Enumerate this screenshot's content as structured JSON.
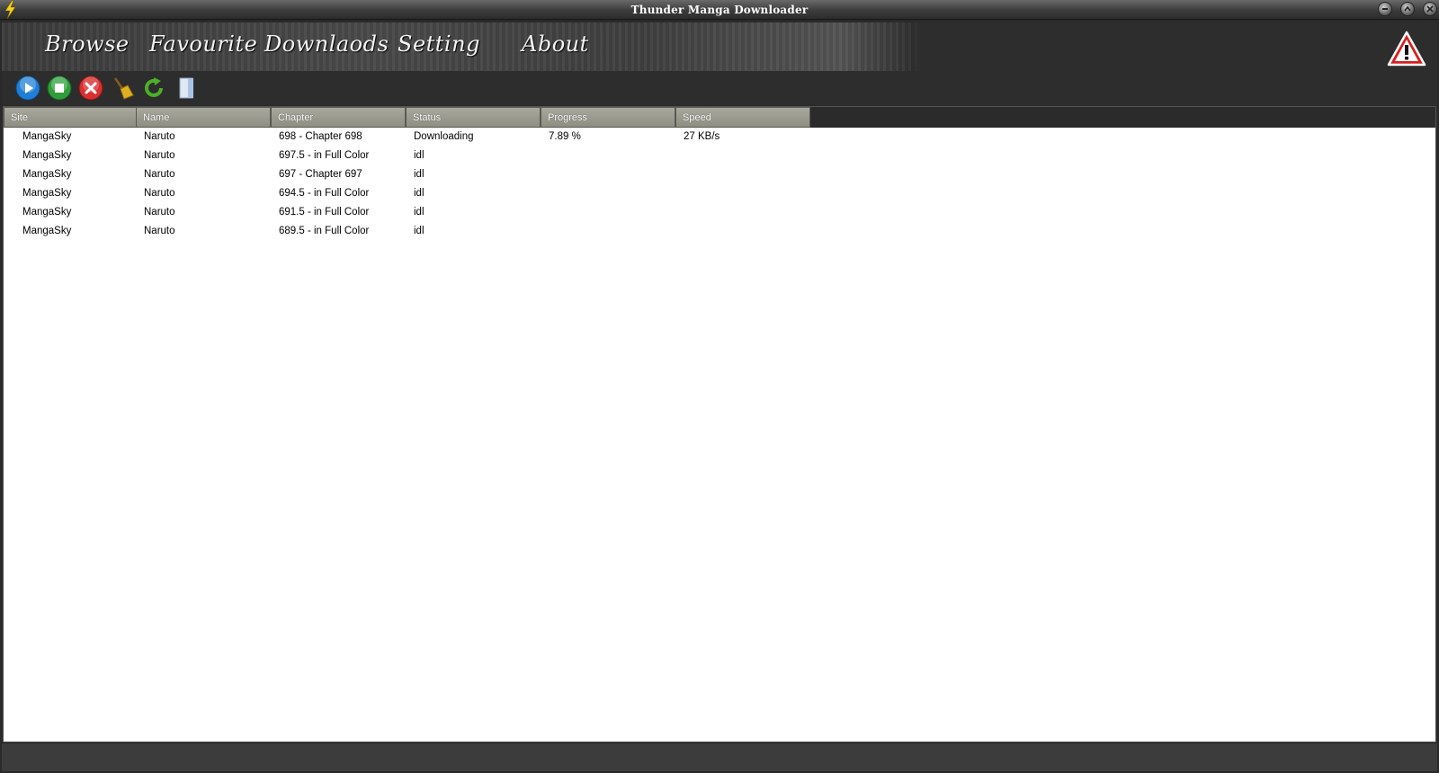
{
  "window": {
    "title": "Thunder Manga Downloader"
  },
  "nav": {
    "items": [
      {
        "label": "Browse"
      },
      {
        "label": "Favourite"
      },
      {
        "label": "Downlaods"
      },
      {
        "label": "Setting"
      },
      {
        "label": "About"
      }
    ]
  },
  "toolbar": {
    "buttons": [
      {
        "icon": "play-icon",
        "color": "#1f7fd6"
      },
      {
        "icon": "stop-icon",
        "color": "#2f9e3a"
      },
      {
        "icon": "cancel-icon",
        "color": "#d83030"
      },
      {
        "icon": "broom-icon",
        "color": "#e0b020"
      },
      {
        "icon": "refresh-icon",
        "color": "#4caf2a"
      },
      {
        "icon": "folder-icon",
        "color": "#c8dcf0"
      }
    ]
  },
  "table": {
    "columns": [
      "Site",
      "Name",
      "Chapter",
      "Status",
      "Progress",
      "Speed"
    ],
    "rows": [
      [
        "MangaSky",
        "Naruto",
        "698 - Chapter 698",
        "Downloading",
        "7.89 %",
        "27 KB/s"
      ],
      [
        "MangaSky",
        "Naruto",
        "697.5 - in Full Color",
        "idl",
        "",
        ""
      ],
      [
        "MangaSky",
        "Naruto",
        "697 - Chapter 697",
        "idl",
        "",
        ""
      ],
      [
        "MangaSky",
        "Naruto",
        "694.5 - in Full Color",
        "idl",
        "",
        ""
      ],
      [
        "MangaSky",
        "Naruto",
        "691.5 - in Full Color",
        "idl",
        "",
        ""
      ],
      [
        "MangaSky",
        "Naruto",
        "689.5 - in Full Color",
        "idl",
        "",
        ""
      ]
    ]
  },
  "colors": {
    "header_bg": "#9a9a8e",
    "window_bg": "#2d2d2d",
    "warning": "#d42020"
  }
}
